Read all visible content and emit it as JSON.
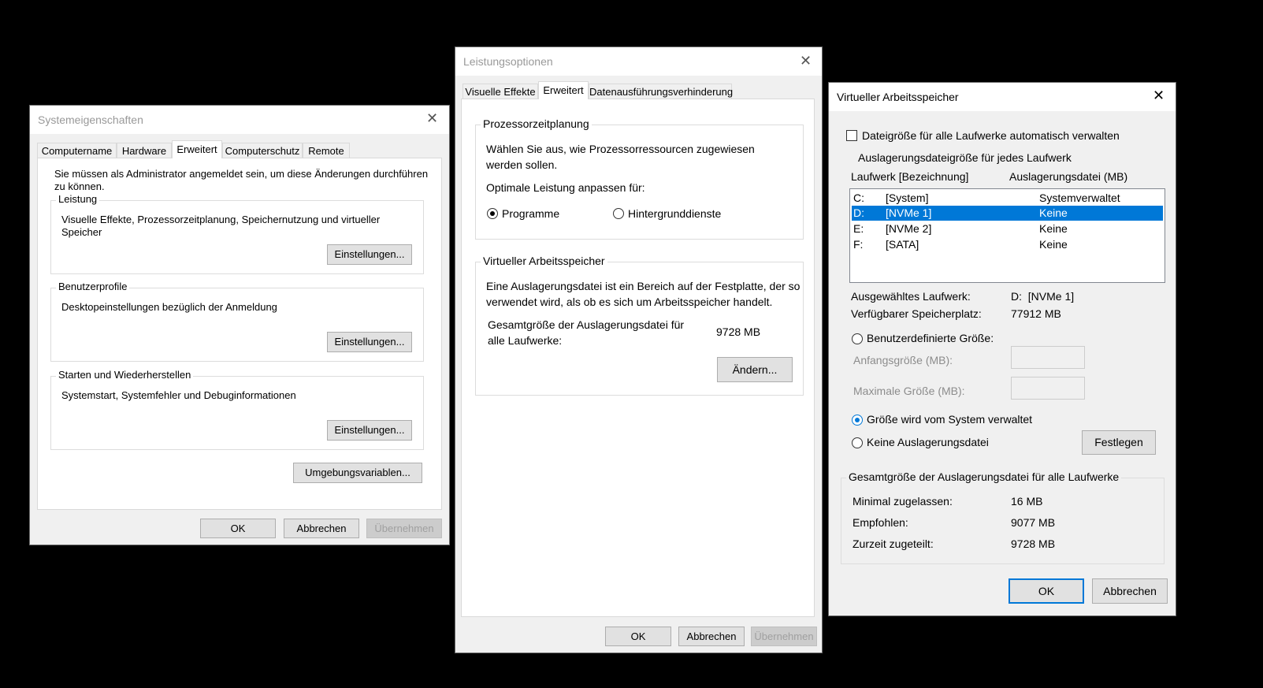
{
  "systemeigenschaften": {
    "title": "Systemeigenschaften",
    "tabs": [
      "Computername",
      "Hardware",
      "Erweitert",
      "Computerschutz",
      "Remote"
    ],
    "admin_notice": "Sie müssen als Administrator angemeldet sein, um diese Änderungen durchführen zu können.",
    "leistung": {
      "heading": "Leistung",
      "description": "Visuelle Effekte, Prozessorzeitplanung, Speichernutzung und virtueller Speicher",
      "button": "Einstellungen..."
    },
    "benutzerprofile": {
      "heading": "Benutzerprofile",
      "description": "Desktopeinstellungen bezüglich der Anmeldung",
      "button": "Einstellungen..."
    },
    "starten": {
      "heading": "Starten und Wiederherstellen",
      "description": "Systemstart, Systemfehler und Debuginformationen",
      "button": "Einstellungen..."
    },
    "env_button": "Umgebungsvariablen...",
    "ok": "OK",
    "cancel": "Abbrechen",
    "apply": "Übernehmen"
  },
  "leistungsoptionen": {
    "title": "Leistungsoptionen",
    "tabs": [
      "Visuelle Effekte",
      "Erweitert",
      "Datenausführungsverhinderung"
    ],
    "prozessor": {
      "heading": "Prozessorzeitplanung",
      "text": "Wählen Sie aus, wie Prozessorressourcen zugewiesen werden sollen.",
      "optimize_label": "Optimale Leistung anpassen für:",
      "option_programs": "Programme",
      "option_background": "Hintergrunddienste"
    },
    "virtuell": {
      "heading": "Virtueller Arbeitsspeicher",
      "text": "Eine Auslagerungsdatei ist ein Bereich auf der Festplatte, der so verwendet wird, als ob es sich um Arbeitsspeicher handelt.",
      "total_label": "Gesamtgröße der Auslagerungsdatei für alle Laufwerke:",
      "total_value": "9728 MB",
      "change_button": "Ändern..."
    },
    "ok": "OK",
    "cancel": "Abbrechen",
    "apply": "Übernehmen"
  },
  "virtueller_arbeitsspeicher": {
    "title": "Virtueller Arbeitsspeicher",
    "auto_manage": "Dateigröße für alle Laufwerke automatisch verwalten",
    "per_drive_heading": "Auslagerungsdateigröße für jedes Laufwerk",
    "col_drive": "Laufwerk [Bezeichnung]",
    "col_pagefile": "Auslagerungsdatei (MB)",
    "drives": [
      {
        "letter": "C:",
        "label": "[System]",
        "pagefile": "Systemverwaltet"
      },
      {
        "letter": "D:",
        "label": "[NVMe 1]",
        "pagefile": "Keine"
      },
      {
        "letter": "E:",
        "label": "[NVMe 2]",
        "pagefile": "Keine"
      },
      {
        "letter": "F:",
        "label": "[SATA]",
        "pagefile": "Keine"
      }
    ],
    "selected_drive_label": "Ausgewähltes Laufwerk:",
    "selected_drive_value": "D:  [NVMe 1]",
    "free_space_label": "Verfügbarer Speicherplatz:",
    "free_space_value": "77912 MB",
    "custom_size": "Benutzerdefinierte Größe:",
    "initial_size_label": "Anfangsgröße (MB):",
    "max_size_label": "Maximale Größe (MB):",
    "system_managed": "Größe wird vom System verwaltet",
    "no_pagefile": "Keine Auslagerungsdatei",
    "set_button": "Festlegen",
    "totals_heading": "Gesamtgröße der Auslagerungsdatei für alle Laufwerke",
    "min_label": "Minimal zugelassen:",
    "min_value": "16 MB",
    "recommended_label": "Empfohlen:",
    "recommended_value": "9077 MB",
    "current_label": "Zurzeit zugeteilt:",
    "current_value": "9728 MB",
    "ok": "OK",
    "cancel": "Abbrechen"
  }
}
